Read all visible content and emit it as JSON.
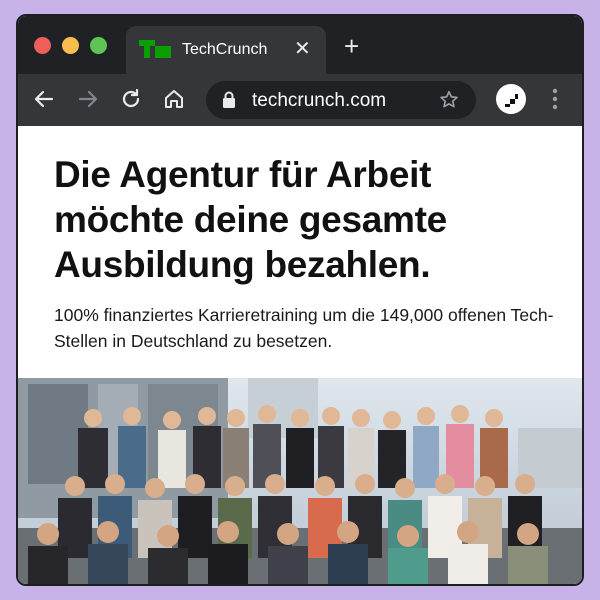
{
  "browser": {
    "tab": {
      "title": "TechCrunch",
      "close_symbol": "✕",
      "logo_icon": "techcrunch-logo",
      "logo_color": "#0a9e01"
    },
    "new_tab_symbol": "+",
    "toolbar": {
      "back_icon": "arrow-left-icon",
      "forward_icon": "arrow-right-icon",
      "reload_icon": "reload-icon",
      "home_icon": "home-icon"
    },
    "omnibox": {
      "url": "techcrunch.com",
      "lock_icon": "lock-icon",
      "bookmark_icon": "star-icon"
    },
    "profile_icon": "profile-avatar",
    "menu_icon": "kebab-menu-icon"
  },
  "ad": {
    "headline": "Die Agentur für Arbeit möchte deine gesamte Ausbildung bezahlen.",
    "subline": "100% finanziertes Karrieretraining um die 149,000 offenen Tech-Stellen in Deutschland zu besetzen.",
    "image": "group-photo"
  },
  "colors": {
    "background": "#c7b3e8",
    "titlebar": "#202124",
    "toolbar": "#35363a"
  }
}
